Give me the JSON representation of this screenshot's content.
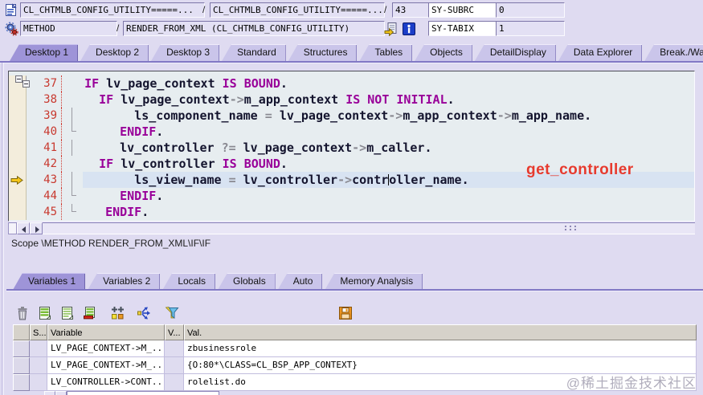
{
  "header": {
    "class_field_1": "CL_CHTMLB_CONFIG_UTILITY=====...",
    "class_field_2": "CL_CHTMLB_CONFIG_UTILITY=====...",
    "separator": "/",
    "line_number_field": "43",
    "sy_subrc_label": "SY-SUBRC",
    "sy_subrc_value": "0",
    "event_type_field": "METHOD",
    "event_name_field": "RENDER_FROM_XML (CL_CHTMLB_CONFIG_UTILITY)",
    "sy_tabix_label": "SY-TABIX",
    "sy_tabix_value": "1"
  },
  "desktop_tabs": [
    {
      "label": "Desktop 1",
      "active": true
    },
    {
      "label": "Desktop 2"
    },
    {
      "label": "Desktop 3"
    },
    {
      "label": "Standard"
    },
    {
      "label": "Structures"
    },
    {
      "label": "Tables"
    },
    {
      "label": "Objects"
    },
    {
      "label": "DetailDisplay"
    },
    {
      "label": "Data Explorer"
    },
    {
      "label": "Break./Watchpoints"
    }
  ],
  "code": {
    "current_line": 43,
    "annotation": "get_controller",
    "scope_label": "Scope \\METHOD RENDER_FROM_XML\\IF\\IF",
    "lines": [
      {
        "num": 37,
        "fold": "box",
        "indent": "  ",
        "segments": [
          {
            "t": "k",
            "s": "IF"
          },
          {
            "t": "i",
            "s": " lv_page_context "
          },
          {
            "t": "k",
            "s": "IS BOUND"
          },
          {
            "t": "i",
            "s": "."
          }
        ]
      },
      {
        "num": 38,
        "fold": "box",
        "indent": "    ",
        "segments": [
          {
            "t": "k",
            "s": "IF"
          },
          {
            "t": "i",
            "s": " lv_page_context"
          },
          {
            "t": "o",
            "s": "->"
          },
          {
            "t": "i",
            "s": "m_app_context "
          },
          {
            "t": "k",
            "s": "IS NOT INITIAL"
          },
          {
            "t": "i",
            "s": "."
          }
        ]
      },
      {
        "num": 39,
        "fold": "line",
        "indent": "      ",
        "segments": [
          {
            "t": "i",
            "s": "ls_component_name "
          },
          {
            "t": "o",
            "s": "= "
          },
          {
            "t": "i",
            "s": "lv_page_context"
          },
          {
            "t": "o",
            "s": "->"
          },
          {
            "t": "i",
            "s": "m_app_context"
          },
          {
            "t": "o",
            "s": "->"
          },
          {
            "t": "i",
            "s": "m_app_name"
          },
          {
            "t": "i",
            "s": "."
          }
        ]
      },
      {
        "num": 40,
        "fold": "end",
        "indent": "    ",
        "segments": [
          {
            "t": "k",
            "s": "ENDIF"
          },
          {
            "t": "i",
            "s": "."
          }
        ]
      },
      {
        "num": 41,
        "fold": "line",
        "indent": "    ",
        "segments": [
          {
            "t": "i",
            "s": "lv_controller "
          },
          {
            "t": "o",
            "s": "?= "
          },
          {
            "t": "i",
            "s": "lv_page_context"
          },
          {
            "t": "o",
            "s": "->"
          },
          {
            "t": "i",
            "s": "m_caller"
          },
          {
            "t": "i",
            "s": "."
          }
        ]
      },
      {
        "num": 42,
        "fold": "box",
        "indent": "    ",
        "segments": [
          {
            "t": "k",
            "s": "IF"
          },
          {
            "t": "i",
            "s": " lv_controller "
          },
          {
            "t": "k",
            "s": "IS BOUND"
          },
          {
            "t": "i",
            "s": "."
          }
        ]
      },
      {
        "num": 43,
        "fold": "line",
        "indent": "      ",
        "segments": [
          {
            "t": "i",
            "s": "ls_view_name "
          },
          {
            "t": "o",
            "s": "= "
          },
          {
            "t": "i",
            "s": "lv_controller"
          },
          {
            "t": "o",
            "s": "->"
          },
          {
            "t": "i",
            "s": "contr"
          },
          {
            "t": "caret",
            "s": ""
          },
          {
            "t": "i",
            "s": "oller_name"
          },
          {
            "t": "i",
            "s": "."
          }
        ]
      },
      {
        "num": 44,
        "fold": "end",
        "indent": "    ",
        "segments": [
          {
            "t": "k",
            "s": "ENDIF"
          },
          {
            "t": "i",
            "s": "."
          }
        ]
      },
      {
        "num": 45,
        "fold": "end",
        "indent": "  ",
        "segments": [
          {
            "t": "k",
            "s": "ENDIF"
          },
          {
            "t": "i",
            "s": "."
          }
        ]
      }
    ]
  },
  "variable_tabs": [
    {
      "label": "Variables 1",
      "active": true
    },
    {
      "label": "Variables 2"
    },
    {
      "label": "Locals"
    },
    {
      "label": "Globals"
    },
    {
      "label": "Auto"
    },
    {
      "label": "Memory Analysis"
    }
  ],
  "variables_table": {
    "columns": {
      "selector": "",
      "s": "S...",
      "variable": "Variable",
      "v": "V...",
      "val": "Val."
    },
    "rows": [
      {
        "variable": "LV_PAGE_CONTEXT->M_...",
        "value": "zbusinessrole"
      },
      {
        "variable": "LV_PAGE_CONTEXT->M_...",
        "value": "{O:80*\\CLASS=CL_BSP_APP_CONTEXT}"
      },
      {
        "variable": "LV_CONTROLLER->CONT...",
        "value": "rolelist.do"
      }
    ]
  },
  "icons": {
    "program-icon": "report/list document",
    "method-icon": "gears",
    "navigate-icon": "document with yellow arrow",
    "info-icon": "blue square white i",
    "current-line-arrow-icon": "yellow right arrow",
    "delete-rows-icon": "trash can",
    "insert-rows-icon": "green striped list page",
    "display-list-icon": "striped list page",
    "remove-row-icon": "list page with red bar",
    "create-variables-icon": "two plus signs over boxes",
    "distribute-icon": "blue branching arrows",
    "filter-icon": "funnel",
    "save-icon": "orange floppy disk"
  },
  "colors": {
    "active_tab": "#9e94d8",
    "keyword": "#990099",
    "line_number": "#c8392f",
    "annotation_red": "#e73a2e",
    "current_line_highlight": "#d8e3f2",
    "code_background": "#e7edf0",
    "breakpoint_margin": "#f3eddc"
  },
  "watermark": "@稀土掘金技术社区"
}
